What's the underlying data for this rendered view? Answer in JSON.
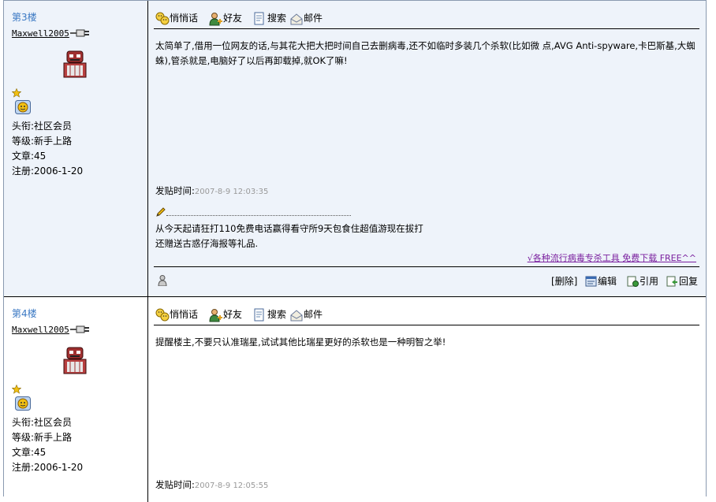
{
  "posts": [
    {
      "floor": "第3楼",
      "username": "Maxwell2005",
      "title": "头衔:社区会员",
      "level": "等级:新手上路",
      "articles": "文章:45",
      "registered": "注册:2006-1-20",
      "toolbar": {
        "whisper": "悄悄话",
        "friend": "好友",
        "search": "搜索",
        "mail": "邮件"
      },
      "content": "太简单了,借用一位网友的话,与其花大把大把时间自己去删病毒,还不如临时多装几个杀软(比如微 点,AVG Anti-spyware,卡巴斯基,大蜘蛛),管杀就是,电脑好了以后再卸载掉,就OK了嘛!",
      "post_time_label": "发贴时间:",
      "post_time": "2007-8-9 12:03:35",
      "signature_line1": "从今天起请狂打110免费电话赢得看守所9天包食住超值游现在拔打",
      "signature_line2": "还赠送古惑仔海报等礼品.",
      "ad_link": "√各种流行病毒专杀工具 免费下载 FREE^^",
      "actions": {
        "delete": "[删除]",
        "edit": "编辑",
        "quote": "引用",
        "reply": "回复"
      }
    },
    {
      "floor": "第4楼",
      "username": "Maxwell2005",
      "title": "头衔:社区会员",
      "level": "等级:新手上路",
      "articles": "文章:45",
      "registered": "注册:2006-1-20",
      "toolbar": {
        "whisper": "悄悄话",
        "friend": "好友",
        "search": "搜索",
        "mail": "邮件"
      },
      "content": "提醒楼主,不要只认准瑞星,试试其他比瑞星更好的杀软也是一种明智之举!",
      "post_time_label": "发贴时间:",
      "post_time": "2007-8-9 12:05:55"
    }
  ],
  "colors": {
    "floor": "#3a78c3",
    "post_bg": "#eef3fa",
    "ad_link": "#7a1f9e",
    "time": "#999999"
  },
  "icons": [
    "plug-icon",
    "robot-avatar",
    "star-icon",
    "medal-icon",
    "whisper-icon",
    "friend-icon",
    "search-icon",
    "mail-icon",
    "pencil-icon",
    "person-icon",
    "edit-icon",
    "quote-icon",
    "reply-icon"
  ]
}
